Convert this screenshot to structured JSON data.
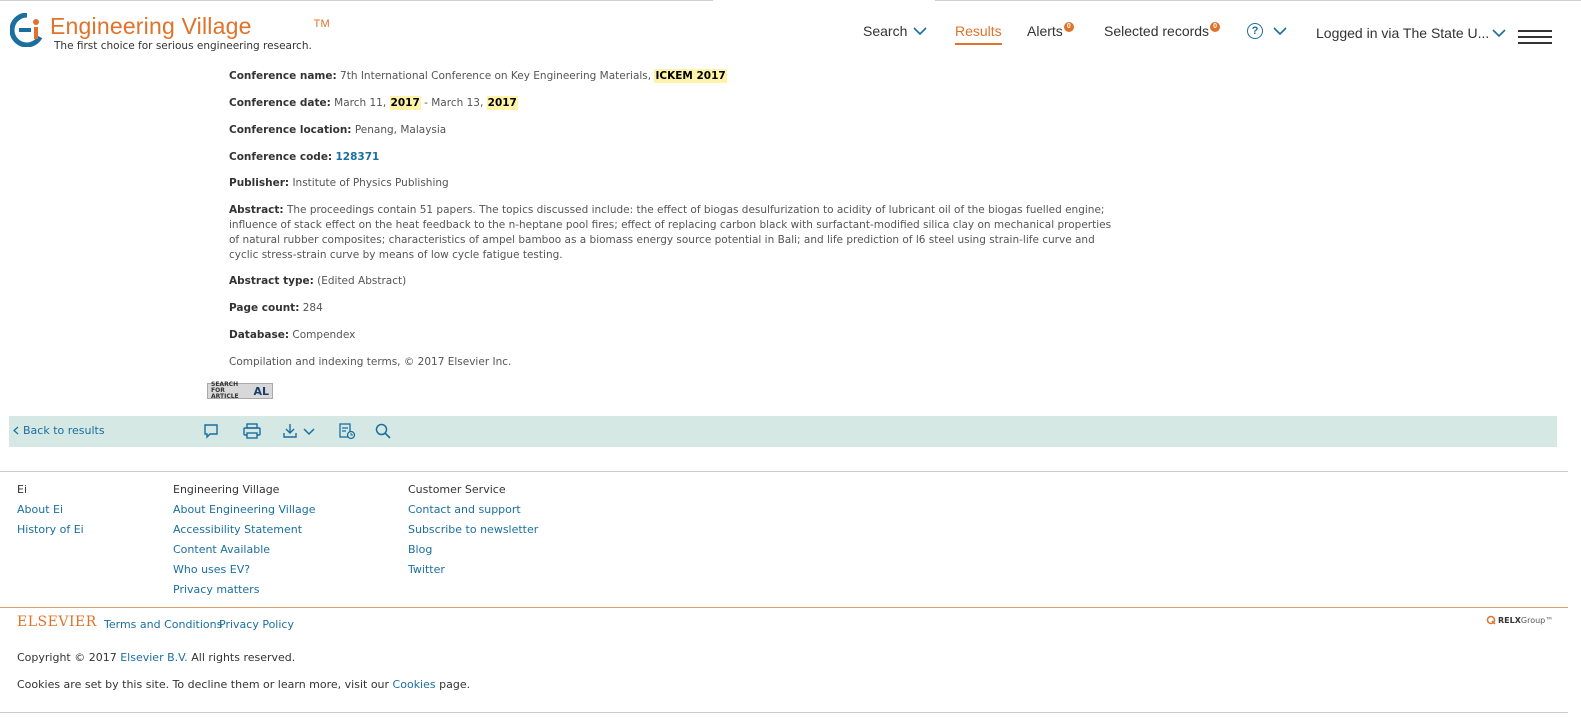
{
  "header": {
    "brand": "Engineering Village",
    "tm": "TM",
    "tagline": "The first choice for serious engineering research.",
    "nav": {
      "search": "Search",
      "results": "Results",
      "alerts": "Alerts",
      "alerts_badge": "0",
      "selected_records": "Selected records",
      "selected_badge": "0",
      "help": "?",
      "login": "Logged in via The State U..."
    }
  },
  "record": {
    "conference_name": {
      "label": "Conference name:",
      "text": "7th International Conference on Key Engineering Materials, ",
      "highlight": "ICKEM 2017"
    },
    "conference_date": {
      "label": "Conference date:",
      "start": "March 11, ",
      "start_year": "2017",
      "sep": " - March 13, ",
      "end_year": "2017"
    },
    "conference_location": {
      "label": "Conference location:",
      "value": "Penang, Malaysia"
    },
    "conference_code": {
      "label": "Conference code:",
      "value": "128371"
    },
    "publisher": {
      "label": "Publisher:",
      "value": "Institute of Physics Publishing"
    },
    "abstract": {
      "label": "Abstract:",
      "value": "The proceedings contain 51 papers. The topics discussed include: the effect of biogas desulfurization to acidity of lubricant oil of the biogas fuelled engine; influence of stack effect on the heat feedback to the n-heptane pool fires; effect of replacing carbon black with surfactant-modified silica clay on mechanical properties of natural rubber composites; characteristics of ampel bamboo as a biomass energy source potential in Bali; and life prediction of l6 steel using strain-life curve and cyclic stress-strain curve by means of low cycle fatigue testing."
    },
    "abstract_type": {
      "label": "Abstract type:",
      "value": "(Edited Abstract)"
    },
    "page_count": {
      "label": "Page count:",
      "value": "284"
    },
    "database": {
      "label": "Database:",
      "value": "Compendex"
    },
    "compilation": "Compilation and indexing terms, © 2017 Elsevier Inc.",
    "search_article": {
      "line1": "SEARCH FOR",
      "line2": "ARTICLE",
      "logo": "AL"
    }
  },
  "toolbar": {
    "back": "Back to results"
  },
  "footer": {
    "col1": {
      "head": "Ei",
      "links": [
        "About Ei",
        "History of Ei"
      ]
    },
    "col2": {
      "head": "Engineering Village",
      "links": [
        "About Engineering Village",
        "Accessibility Statement",
        "Content Available",
        "Who uses EV?",
        "Privacy matters"
      ]
    },
    "col3": {
      "head": "Customer Service",
      "links": [
        "Contact and support",
        "Subscribe to newsletter",
        "Blog",
        "Twitter"
      ]
    },
    "elsevier": "ELSEVIER",
    "terms": "Terms and Conditions",
    "privacy": "Privacy Policy",
    "relx": "RELX",
    "relx_group": "Group™",
    "copyright_pre": "Copyright © 2017 ",
    "copyright_link": "Elsevier B.V.",
    "copyright_post": " All rights reserved.",
    "cookies_pre": "Cookies are set by this site. To decline them or learn more, visit our ",
    "cookies_link": "Cookies",
    "cookies_post": " page."
  },
  "colors": {
    "accent": "#e0722a",
    "link": "#1a6fa0",
    "toolbar_bg": "#d5e8e3",
    "highlight": "#fff3a8"
  }
}
